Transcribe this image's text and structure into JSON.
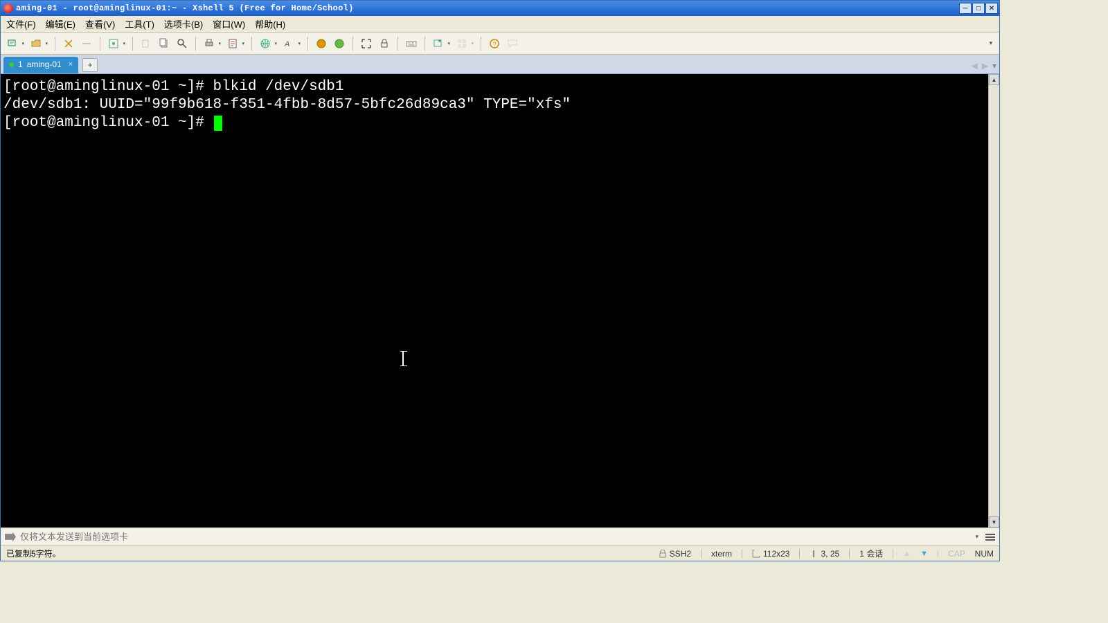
{
  "window": {
    "title": "aming-01 - root@aminglinux-01:~ - Xshell 5 (Free for Home/School)"
  },
  "menu": {
    "file": "文件(F)",
    "edit": "编辑(E)",
    "view": "查看(V)",
    "tools": "工具(T)",
    "tabs": "选项卡(B)",
    "window": "窗口(W)",
    "help": "帮助(H)"
  },
  "tab": {
    "index": "1",
    "label": "aming-01"
  },
  "terminal": {
    "line1_prompt": "[root@aminglinux-01 ~]# ",
    "line1_cmd": "blkid /dev/sdb1",
    "line2": "/dev/sdb1: UUID=\"99f9b618-f351-4fbb-8d57-5bfc26d89ca3\" TYPE=\"xfs\"",
    "line3_prompt": "[root@aminglinux-01 ~]# "
  },
  "sendbar": {
    "placeholder": "仅将文本发送到当前选项卡"
  },
  "status": {
    "left": "已复制5字符。",
    "ssh": "SSH2",
    "term": "xterm",
    "size": "112x23",
    "pos": "3, 25",
    "sess": "1 会话",
    "cap": "CAP",
    "num": "NUM"
  }
}
